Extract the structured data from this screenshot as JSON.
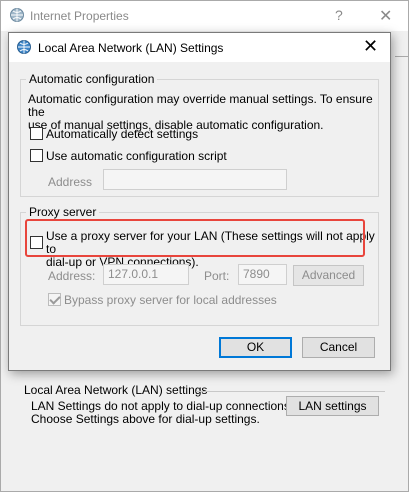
{
  "parent_window": {
    "title": "Internet Properties",
    "help_label": "?",
    "close_label": "✕",
    "lan_group": {
      "title": "Local Area Network (LAN) settings",
      "text_line1": "LAN Settings do not apply to dial-up connections.",
      "text_line2": "Choose Settings above for dial-up settings.",
      "button_label": "LAN settings"
    }
  },
  "dialog": {
    "title": "Local Area Network (LAN) Settings",
    "close_label": "✕",
    "auto_config": {
      "title": "Automatic configuration",
      "desc_line1": "Automatic configuration may override manual settings.  To ensure the",
      "desc_line2": "use of manual settings, disable automatic configuration.",
      "detect_label": "Automatically detect settings",
      "detect_checked": false,
      "script_label": "Use automatic configuration script",
      "script_checked": false,
      "address_label": "Address",
      "address_value": ""
    },
    "proxy": {
      "title": "Proxy server",
      "use_proxy_line1": "Use a proxy server for your LAN (These settings will not apply to",
      "use_proxy_line2": "dial-up or VPN connections).",
      "use_proxy_checked": false,
      "address_label": "Address:",
      "address_value": "127.0.0.1",
      "port_label": "Port:",
      "port_value": "7890",
      "advanced_label": "Advanced",
      "bypass_label": "Bypass proxy server for local addresses",
      "bypass_checked": true
    },
    "ok_label": "OK",
    "cancel_label": "Cancel"
  },
  "colors": {
    "highlight": "#e8453c",
    "accent": "#0078d7"
  }
}
